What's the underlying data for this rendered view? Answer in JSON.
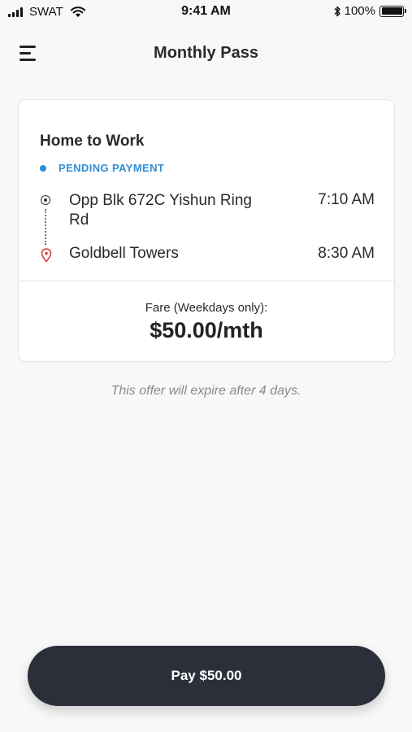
{
  "status_bar": {
    "carrier": "SWAT",
    "time": "9:41 AM",
    "battery": "100%",
    "icons": [
      "signal-icon",
      "wifi-icon",
      "bluetooth-icon",
      "battery-icon"
    ]
  },
  "nav": {
    "title": "Monthly Pass",
    "menu_icon": "hamburger-menu-icon"
  },
  "card": {
    "title": "Home to Work",
    "status": "PENDING PAYMENT",
    "status_color": "#2f8fd6",
    "origin": {
      "name": "Opp Blk 672C Yishun Ring Rd",
      "time": "7:10 AM",
      "icon": "origin-dot-icon"
    },
    "destination": {
      "name": "Goldbell Towers",
      "time": "8:30 AM",
      "icon": "location-pin-icon",
      "icon_color": "#d9403a"
    },
    "fare_label": "Fare (Weekdays only):",
    "fare_amount": "$50.00/mth"
  },
  "expiry_note": "This offer will expire after 4 days.",
  "pay_button": {
    "label": "Pay $50.00",
    "color": "#2b2f3a"
  }
}
